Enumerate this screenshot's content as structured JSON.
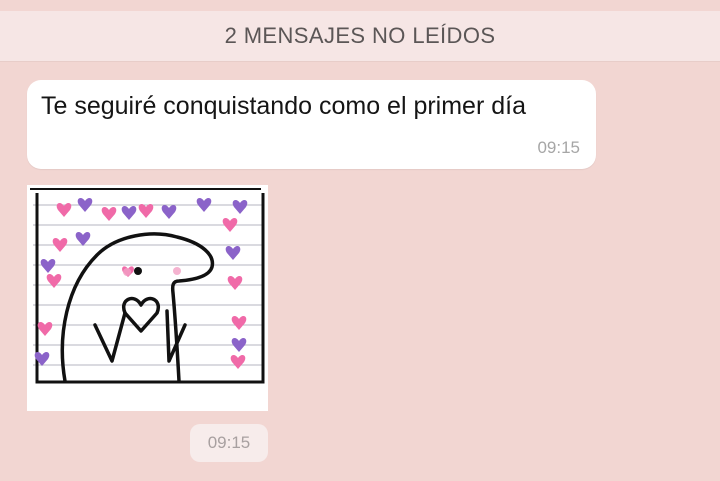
{
  "chat": {
    "unread_banner": "2 MENSAJES NO LEÍDOS",
    "messages": [
      {
        "type": "text",
        "text": "Te seguiré conquistando como el primer día",
        "time": "09:15"
      },
      {
        "type": "sticker",
        "sticker_icon": "flork-heart-sticker-icon",
        "time": "09:15"
      }
    ]
  },
  "colors": {
    "background": "#f2d6d2",
    "banner": "#f6e6e5",
    "bubble": "#ffffff",
    "pink_hearts": "#f06aa8",
    "purple_hearts": "#8b63c9"
  }
}
